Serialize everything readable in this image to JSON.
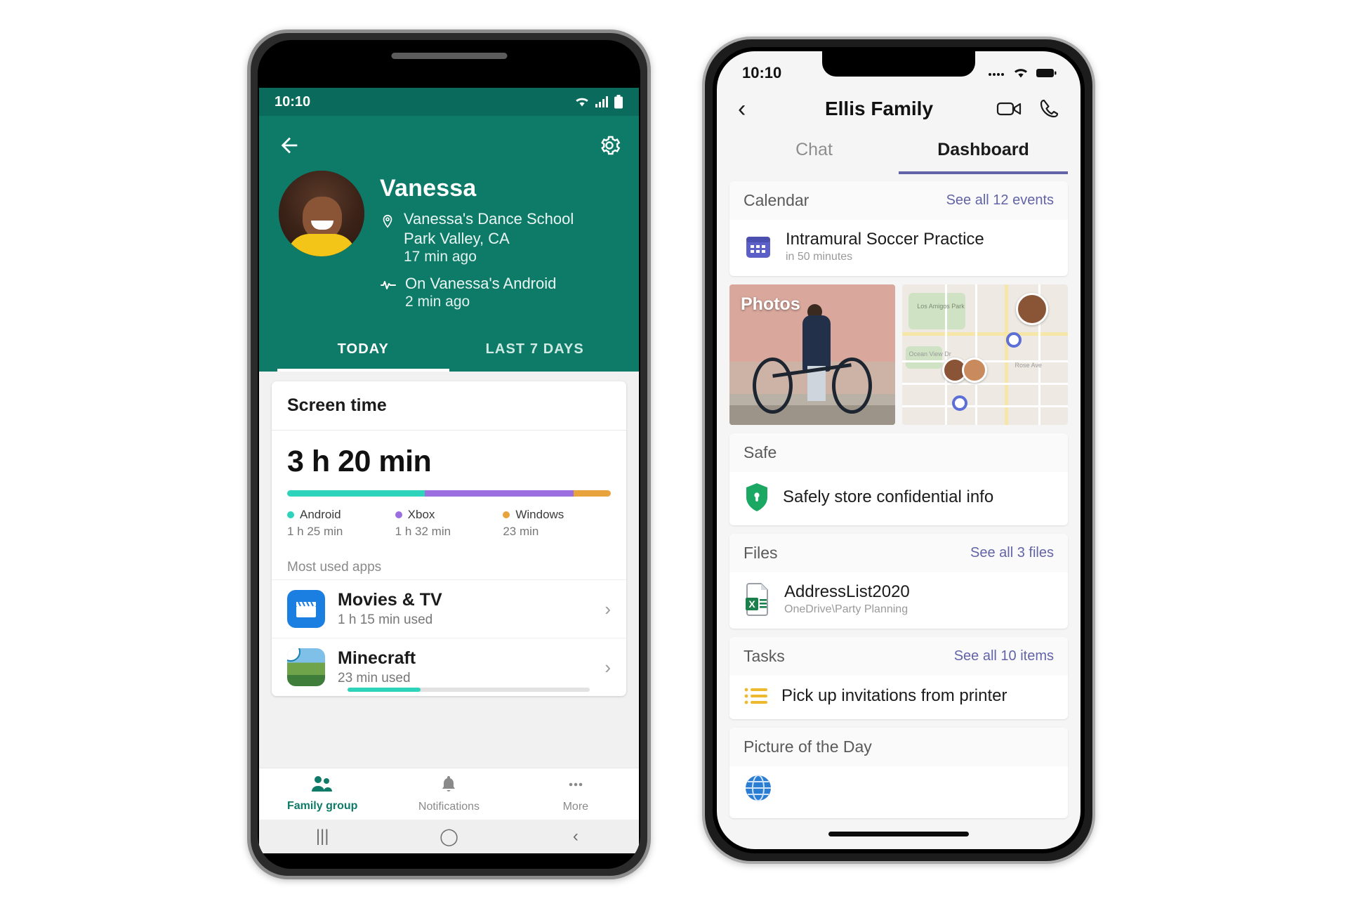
{
  "android": {
    "status": {
      "time": "10:10",
      "icons": [
        "wifi-icon",
        "signal-icon",
        "battery-icon"
      ]
    },
    "header": {
      "back_icon": "back-arrow-icon",
      "settings_icon": "gear-icon",
      "name": "Vanessa",
      "location_icon": "location-pin-icon",
      "location_line1": "Vanessa's Dance School",
      "location_line2": "Park Valley, CA",
      "location_time": "17 min ago",
      "activity_icon": "pulse-icon",
      "activity_text": "On Vanessa's Android",
      "activity_time": "2 min ago"
    },
    "tabs": [
      {
        "label": "TODAY",
        "active": true
      },
      {
        "label": "LAST 7 DAYS",
        "active": false
      }
    ],
    "screen_time": {
      "card_title": "Screen time",
      "total": "3 h 20 min",
      "most_used_label": "Most used apps",
      "apps": [
        {
          "name": "Movies & TV",
          "usage": "1 h 15 min used",
          "icon": "movies-tv-icon",
          "chevron": "chevron-right-icon"
        },
        {
          "name": "Minecraft",
          "usage": "23 min used",
          "icon": "minecraft-icon",
          "chevron": "chevron-right-icon"
        }
      ]
    },
    "bottom_nav": [
      {
        "label": "Family group",
        "icon": "family-group-icon",
        "active": true
      },
      {
        "label": "Notifications",
        "icon": "bell-icon",
        "active": false
      },
      {
        "label": "More",
        "icon": "more-dots-icon",
        "active": false
      }
    ],
    "system_nav": [
      {
        "icon": "recents-icon",
        "glyph": "|||"
      },
      {
        "icon": "home-icon",
        "glyph": "◯"
      },
      {
        "icon": "back-icon",
        "glyph": "‹"
      }
    ]
  },
  "chart_data": {
    "type": "bar",
    "title": "Screen time",
    "subtitle": "3 h 20 min",
    "categories": [
      "Android",
      "Xbox",
      "Windows"
    ],
    "values": [
      85,
      92,
      23
    ],
    "value_labels": [
      "1 h 25 min",
      "1 h 32 min",
      "23 min"
    ],
    "unit": "minutes",
    "total_minutes": 200,
    "colors": [
      "#2ed3bb",
      "#9b6fe0",
      "#e8a33d"
    ],
    "legend_position": "bottom",
    "grid": false,
    "xlabel": "",
    "ylabel": ""
  },
  "ios": {
    "status": {
      "time": "10:10",
      "icons": [
        "cellular-icon",
        "wifi-icon",
        "battery-icon"
      ]
    },
    "nav": {
      "back_icon": "chevron-left-icon",
      "title": "Ellis Family",
      "video_icon": "video-call-icon",
      "phone_icon": "phone-call-icon"
    },
    "tabs": [
      {
        "label": "Chat",
        "active": false
      },
      {
        "label": "Dashboard",
        "active": true
      }
    ],
    "cards": {
      "calendar": {
        "title": "Calendar",
        "link": "See all 12 events",
        "icon": "calendar-icon",
        "item_title": "Intramural Soccer Practice",
        "item_sub": "in 50 minutes"
      },
      "photos": {
        "label": "Photos"
      },
      "map": {
        "park_label": "Los Amigos Park",
        "street_labels": [
          "Ocean View Dr",
          "Rose Ave"
        ]
      },
      "safe": {
        "title": "Safe",
        "icon": "shield-lock-icon",
        "item_title": "Safely store confidential info"
      },
      "files": {
        "title": "Files",
        "link": "See all 3 files",
        "icon": "excel-file-icon",
        "item_title": "AddressList2020",
        "item_sub": "OneDrive\\Party Planning"
      },
      "tasks": {
        "title": "Tasks",
        "link": "See all 10 items",
        "icon": "task-list-icon",
        "item_title": "Pick up invitations from printer"
      },
      "picture_of_day": {
        "title": "Picture of the Day",
        "icon": "globe-icon"
      }
    }
  },
  "colors": {
    "android_teal": "#0e7a68",
    "android_teal_dark": "#0a6b5d",
    "accent_purple": "#6264a7",
    "android_green": "#2ed3bb",
    "xbox_purple": "#9b6fe0",
    "windows_orange": "#e8a33d",
    "safe_green": "#18a558",
    "tasks_yellow": "#edb92e"
  }
}
